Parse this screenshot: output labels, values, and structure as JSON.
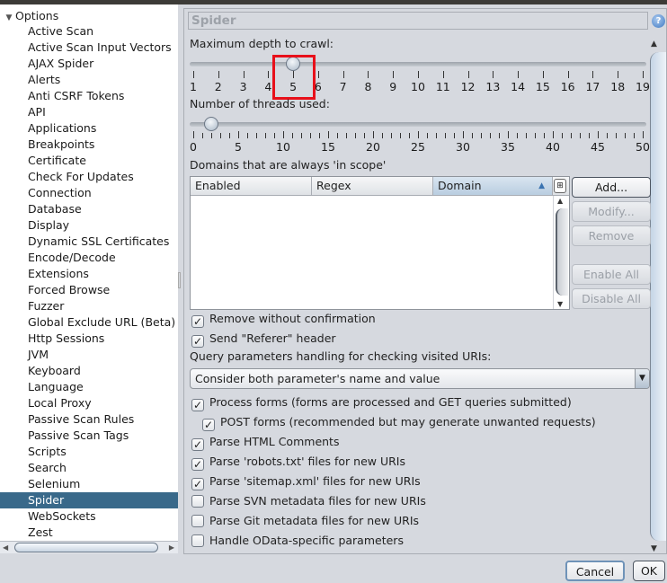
{
  "tree": {
    "root_label": "Options",
    "items": [
      "Active Scan",
      "Active Scan Input Vectors",
      "AJAX Spider",
      "Alerts",
      "Anti CSRF Tokens",
      "API",
      "Applications",
      "Breakpoints",
      "Certificate",
      "Check For Updates",
      "Connection",
      "Database",
      "Display",
      "Dynamic SSL Certificates",
      "Encode/Decode",
      "Extensions",
      "Forced Browse",
      "Fuzzer",
      "Global Exclude URL (Beta)",
      "Http Sessions",
      "JVM",
      "Keyboard",
      "Language",
      "Local Proxy",
      "Passive Scan Rules",
      "Passive Scan Tags",
      "Scripts",
      "Search",
      "Selenium",
      "Spider",
      "WebSockets",
      "Zest"
    ],
    "selected": "Spider"
  },
  "panel": {
    "title": "Spider",
    "help_icon": "?",
    "max_depth": {
      "label": "Maximum depth to crawl:",
      "min": 1,
      "max": 19,
      "value": 5,
      "tick_labels": [
        "1",
        "2",
        "3",
        "4",
        "5",
        "6",
        "7",
        "8",
        "9",
        "10",
        "11",
        "12",
        "13",
        "14",
        "15",
        "16",
        "17",
        "18",
        "19"
      ]
    },
    "threads": {
      "label": "Number of threads used:",
      "min": 0,
      "max": 50,
      "value": 2,
      "tick_labels": [
        "0",
        "5",
        "10",
        "15",
        "20",
        "25",
        "30",
        "35",
        "40",
        "45",
        "50"
      ]
    },
    "domains": {
      "label": "Domains that are always 'in scope'",
      "columns": [
        "Enabled",
        "Regex",
        "Domain"
      ],
      "sorted_column": "Domain",
      "rows": [],
      "buttons": {
        "add": "Add...",
        "modify": "Modify...",
        "remove": "Remove",
        "enable_all": "Enable All",
        "disable_all": "Disable All"
      }
    },
    "remove_without_confirmation": {
      "label": "Remove without confirmation",
      "checked": true
    },
    "send_referer": {
      "label": "Send \"Referer\" header",
      "checked": true
    },
    "query_params": {
      "label": "Query parameters handling for checking visited URIs:",
      "selected": "Consider both parameter's name and value"
    },
    "options": [
      {
        "label": "Process forms (forms are processed and GET queries submitted)",
        "checked": true
      },
      {
        "label": "POST forms (recommended but may generate unwanted requests)",
        "checked": true
      },
      {
        "label": "Parse HTML Comments",
        "checked": true
      },
      {
        "label": "Parse 'robots.txt' files for new URIs",
        "checked": true
      },
      {
        "label": "Parse 'sitemap.xml' files for new URIs",
        "checked": true
      },
      {
        "label": "Parse SVN metadata files for new URIs",
        "checked": false
      },
      {
        "label": "Parse Git metadata files for new URIs",
        "checked": false
      },
      {
        "label": "Handle OData-specific parameters",
        "checked": false
      }
    ]
  },
  "footer": {
    "cancel": "Cancel",
    "ok": "OK"
  },
  "icons": {
    "check": "✓",
    "tree_expanded": "▼",
    "scroll_up": "▲",
    "scroll_down": "▼",
    "scroll_left": "◀",
    "scroll_right": "▶",
    "sort_asc": "▲",
    "column_chooser": "⊞"
  }
}
